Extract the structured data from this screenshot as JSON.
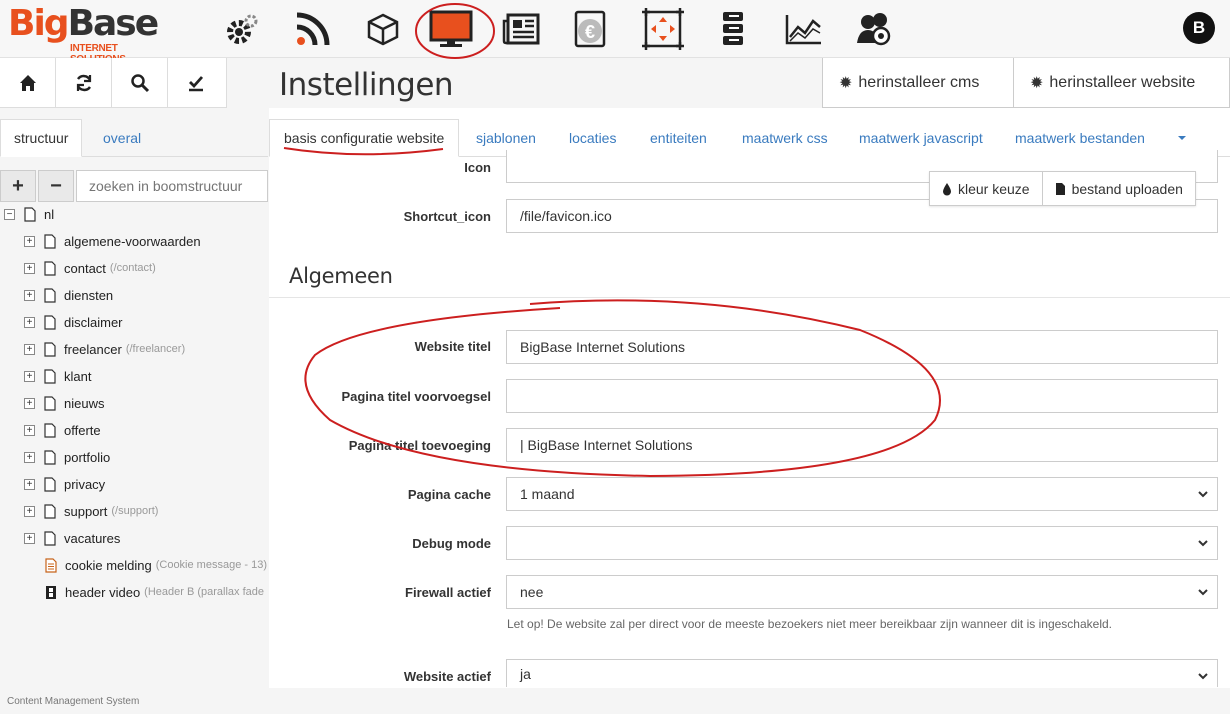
{
  "brand": {
    "logo_big": "Big",
    "logo_base": "Base",
    "logo_sub": "INTERNET SOLUTIONS"
  },
  "topnav": [
    {
      "name": "settings-gear-icon"
    },
    {
      "name": "rss-feed-icon"
    },
    {
      "name": "package-box-icon"
    },
    {
      "name": "website-monitor-icon"
    },
    {
      "name": "newspaper-icon"
    },
    {
      "name": "euro-icon"
    },
    {
      "name": "resize-frame-icon"
    },
    {
      "name": "server-stack-icon"
    },
    {
      "name": "line-chart-icon"
    },
    {
      "name": "users-group-icon"
    }
  ],
  "user": {
    "avatar_initial": "B"
  },
  "toolbar": {
    "home": "home-icon",
    "refresh": "refresh-icon",
    "search": "search-icon",
    "check": "check-icon"
  },
  "page": {
    "title": "Instellingen"
  },
  "header_buttons": {
    "reinstall_cms": "herinstalleer cms",
    "reinstall_website": "herinstalleer website"
  },
  "left_tabs": {
    "structure": "structuur",
    "overall": "overal"
  },
  "tree_controls": {
    "expand": "+",
    "collapse": "−",
    "search_placeholder": "zoeken in boomstructuur"
  },
  "tree": {
    "root": "nl",
    "items": [
      {
        "label": "algemene-voorwaarden",
        "sub": ""
      },
      {
        "label": "contact",
        "sub": "(/contact)"
      },
      {
        "label": "diensten",
        "sub": ""
      },
      {
        "label": "disclaimer",
        "sub": ""
      },
      {
        "label": "freelancer",
        "sub": "(/freelancer)"
      },
      {
        "label": "klant",
        "sub": ""
      },
      {
        "label": "nieuws",
        "sub": ""
      },
      {
        "label": "offerte",
        "sub": ""
      },
      {
        "label": "portfolio",
        "sub": ""
      },
      {
        "label": "privacy",
        "sub": ""
      },
      {
        "label": "support",
        "sub": "(/support)"
      },
      {
        "label": "vacatures",
        "sub": ""
      }
    ],
    "special": [
      {
        "label": "cookie melding",
        "sub": "(Cookie message - 13)"
      },
      {
        "label": "header video",
        "sub": "(Header B (parallax fade"
      }
    ]
  },
  "tabs": [
    "basis configuratie website",
    "sjablonen",
    "locaties",
    "entiteiten",
    "maatwerk css",
    "maatwerk javascript",
    "maatwerk bestanden"
  ],
  "popup": {
    "color_pick": "kleur keuze",
    "file_upload": "bestand uploaden"
  },
  "form": {
    "icon_label": "Icon",
    "icon_value": "",
    "shortcut_label": "Shortcut_icon",
    "shortcut_value": "/file/favicon.ico",
    "section": "Algemeen",
    "website_title_label": "Website titel",
    "website_title_value": "BigBase Internet Solutions",
    "prefix_label": "Pagina titel voorvoegsel",
    "prefix_value": "",
    "suffix_label": "Pagina titel toevoeging",
    "suffix_value": " | BigBase Internet Solutions",
    "cache_label": "Pagina cache",
    "cache_value": "1 maand",
    "debug_label": "Debug mode",
    "debug_value": "",
    "firewall_label": "Firewall actief",
    "firewall_value": "nee",
    "firewall_help": "Let op! De website zal per direct voor de meeste bezoekers niet meer bereikbaar zijn wanneer dit is ingeschakeld.",
    "active_label": "Website actief",
    "active_value": "ja"
  },
  "footer": {
    "text": "Content Management System"
  },
  "colors": {
    "accent": "#e8501e",
    "link": "#3a7bbf",
    "annotation": "#cc1f1f"
  }
}
